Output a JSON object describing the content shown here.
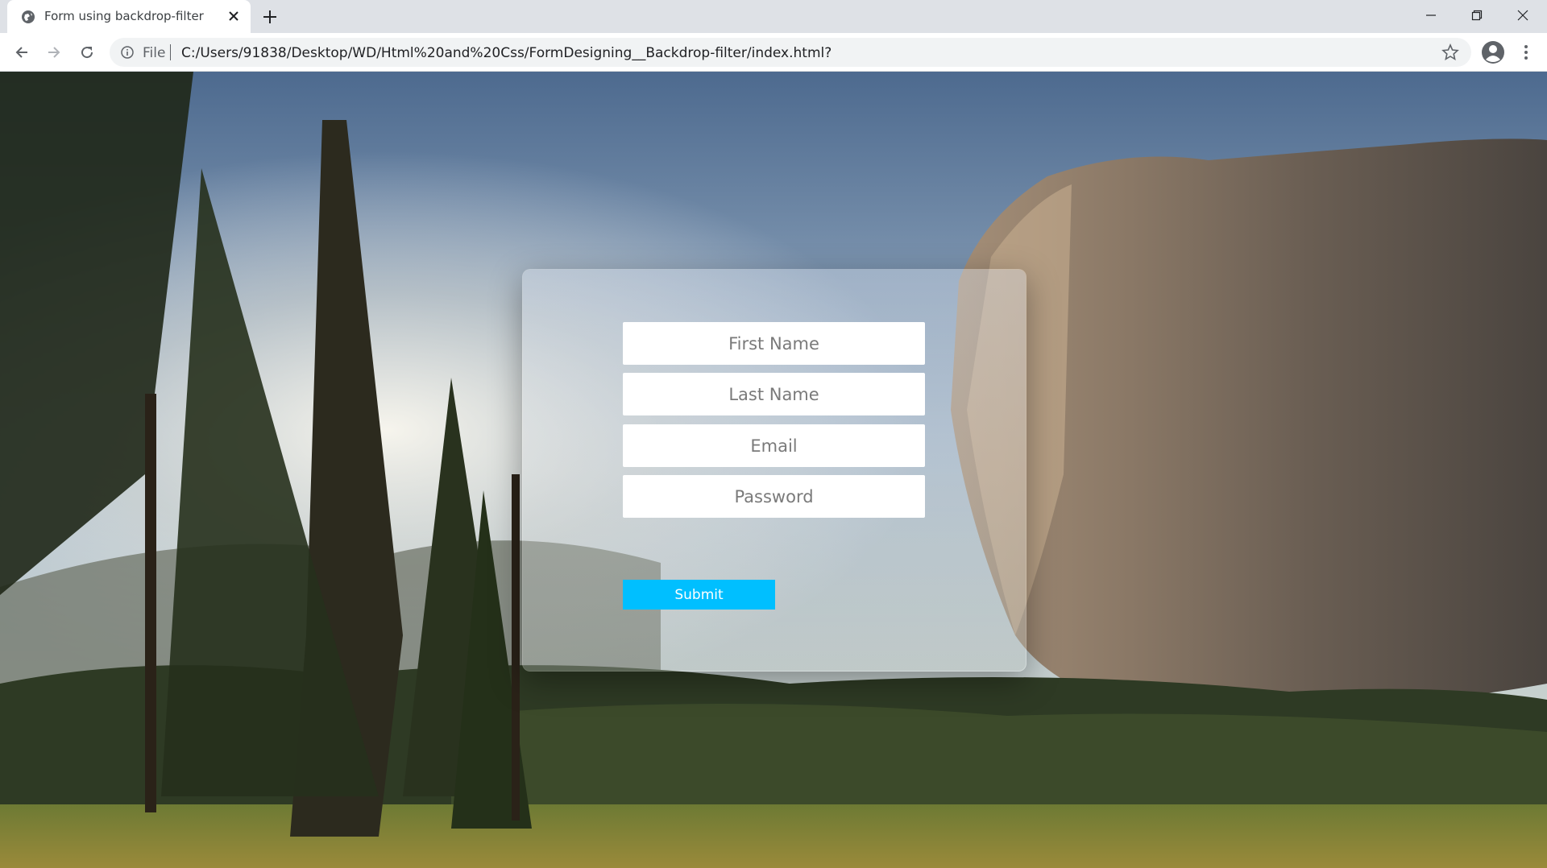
{
  "browser": {
    "tab_title": "Form using backdrop-filter",
    "scheme_label": "File",
    "url": "C:/Users/91838/Desktop/WD/Html%20and%20Css/FormDesigning__Backdrop-filter/index.html?"
  },
  "form": {
    "first_name_placeholder": "First Name",
    "last_name_placeholder": "Last Name",
    "email_placeholder": "Email",
    "password_placeholder": "Password",
    "submit_label": "Submit"
  },
  "colors": {
    "submit_bg": "#00bfff",
    "tab_bg": "#ffffff",
    "tabstrip_bg": "#dee1e6"
  },
  "icons": [
    "globe-icon",
    "close-icon",
    "plus-icon",
    "minimize-icon",
    "restore-icon",
    "window-close-icon",
    "back-arrow-icon",
    "forward-arrow-icon",
    "reload-icon",
    "info-icon",
    "star-icon",
    "profile-icon",
    "kebab-menu-icon"
  ]
}
